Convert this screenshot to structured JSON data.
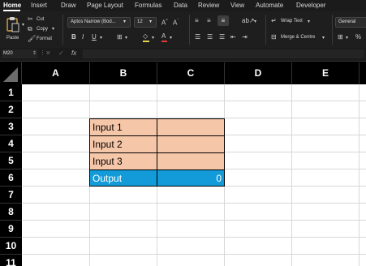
{
  "menu": {
    "tabs": [
      "Home",
      "Insert",
      "Draw",
      "Page Layout",
      "Formulas",
      "Data",
      "Review",
      "View",
      "Automate",
      "Developer"
    ]
  },
  "ribbon": {
    "paste_label": "Paste",
    "cut_label": "Cut",
    "copy_label": "Copy",
    "format_label": "Format",
    "font_name": "Aptos Narrow (Bod...",
    "font_size": "12",
    "wrap_text_label": "Wrap Text",
    "merge_label": "Merge & Centre",
    "number_format": "General",
    "percent_symbol": "%"
  },
  "formula_bar": {
    "name_box": "M20",
    "fx_label": "fx",
    "formula": ""
  },
  "grid": {
    "columns": [
      "A",
      "B",
      "C",
      "D",
      "E"
    ],
    "rows": [
      "1",
      "2",
      "3",
      "4",
      "5",
      "6",
      "7",
      "8",
      "9",
      "10",
      "11"
    ],
    "cells": {
      "B3": "Input 1",
      "B4": "Input 2",
      "B5": "Input 3",
      "B6": "Output",
      "C6": "0"
    }
  },
  "colors": {
    "input_fill": "#f6c6a9",
    "output_fill": "#129bd8"
  }
}
